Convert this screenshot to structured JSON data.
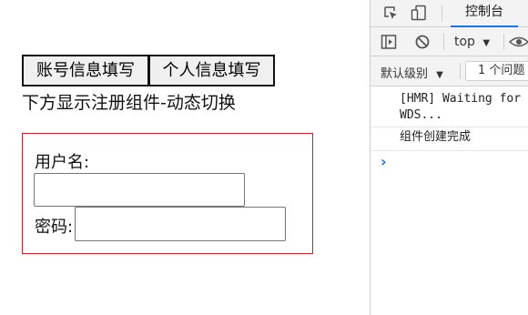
{
  "app": {
    "tabs": [
      {
        "label": "账号信息填写"
      },
      {
        "label": "个人信息填写"
      }
    ],
    "hint": "下方显示注册组件-动态切换",
    "form": {
      "username_label": "用户名:",
      "username_value": "",
      "password_label": "密码:",
      "password_value": ""
    },
    "colors": {
      "component_border": "#d0202a"
    }
  },
  "devtools": {
    "tabs": {
      "console_label": "控制台"
    },
    "toolbar": {
      "context": "top"
    },
    "filter": {
      "levels_label": "默认级别",
      "issues_label": "1 个问题"
    },
    "logs": [
      {
        "line1": "[HMR] Waiting for",
        "line2": "WDS..."
      },
      {
        "line1": "组件创建完成"
      }
    ],
    "prompt": "›",
    "colors": {
      "accent": "#1a73e8"
    }
  }
}
